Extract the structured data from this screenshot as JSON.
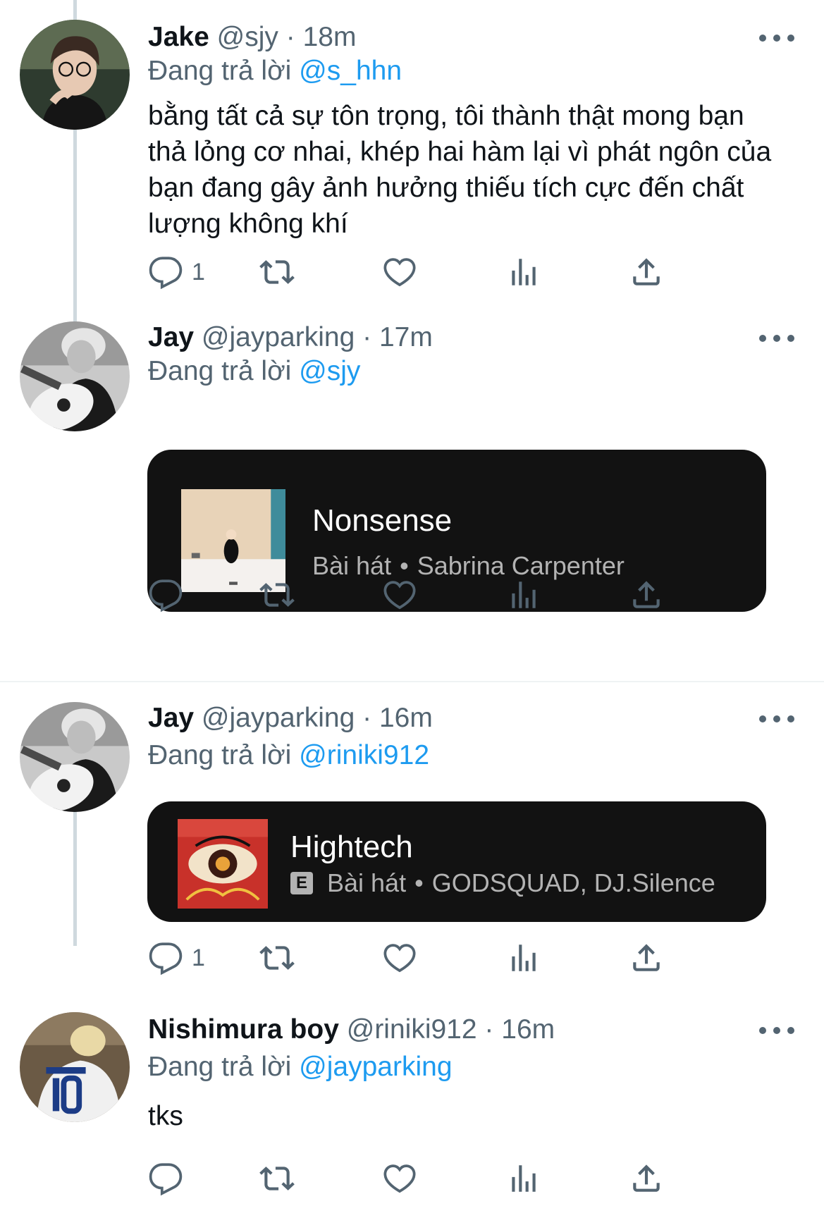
{
  "tweets": [
    {
      "name": "Jake",
      "handle": "@sjy",
      "separator": "·",
      "time": "18m",
      "reply_prefix": "Đang trả lời",
      "reply_to": "@s_hhn",
      "text": "bằng tất cả sự tôn trọng, tôi thành thật mong bạn thả lỏng cơ nhai, khép hai hàm lại vì phát ngôn của bạn đang gây ảnh hưởng thiếu tích cực đến chất lượng không khí",
      "reply_count": "1"
    },
    {
      "name": "Jay",
      "handle": "@jayparking",
      "separator": "·",
      "time": "17m",
      "reply_prefix": "Đang trả lời",
      "reply_to": "@sjy",
      "card": {
        "title": "Nonsense",
        "type": "Bài hát",
        "dot": "•",
        "artist": "Sabrina Carpenter"
      },
      "reply_count": ""
    },
    {
      "name": "Jay",
      "handle": "@jayparking",
      "separator": "·",
      "time": "16m",
      "reply_prefix": "Đang trả lời",
      "reply_to": "@riniki912",
      "card": {
        "title": "Hightech",
        "explicit_badge": "E",
        "type": "Bài hát",
        "dot": "•",
        "artist": "GODSQUAD, DJ.Silence"
      },
      "reply_count": "1"
    },
    {
      "name": "Nishimura boy",
      "handle": "@riniki912",
      "separator": "·",
      "time": "16m",
      "reply_prefix": "Đang trả lời",
      "reply_to": "@jayparking",
      "text": "tks",
      "reply_count": ""
    }
  ],
  "colors": {
    "link": "#1d9bf0",
    "secondary_text": "#536471",
    "card_bg": "#121212",
    "thread_line": "#cfd9de"
  },
  "icons": [
    "reply-icon",
    "retweet-icon",
    "like-icon",
    "views-icon",
    "share-icon",
    "more-icon"
  ]
}
